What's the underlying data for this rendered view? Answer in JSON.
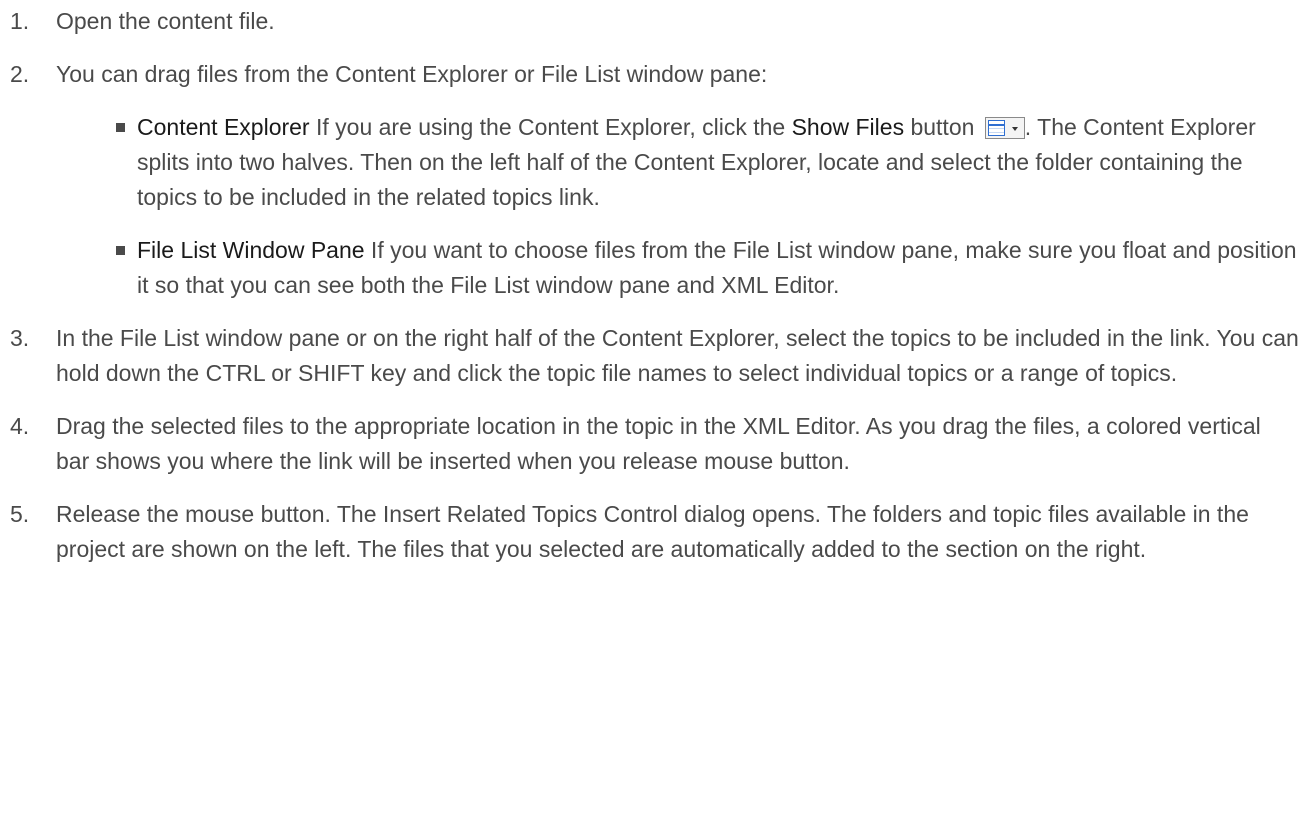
{
  "steps": [
    {
      "number": "1.",
      "text": "Open the content file."
    },
    {
      "number": "2.",
      "text": "You can drag files from the Content Explorer or File List window pane:",
      "subitems": [
        {
          "term": "Content Explorer",
          "text_a": " If you are using the Content Explorer, click the ",
          "button_name": "Show Files",
          "text_b": " button ",
          "text_c": ". The Content Explorer splits into two halves. Then on the left half of the Content Explorer, locate and select the folder containing the topics to be included in the related topics link.",
          "icon": "show-files-icon"
        },
        {
          "term": "File List Window Pane",
          "text": " If you want to choose files from the File List window pane, make sure you float and position it so that you can see both the File List window pane and XML Editor."
        }
      ]
    },
    {
      "number": "3.",
      "text": "In the File List window pane or on the right half of the Content Explorer, select the topics to be included in the link. You can hold down the CTRL or SHIFT key and click the topic file names to select individual topics or a range of topics."
    },
    {
      "number": "4.",
      "text": "Drag the selected files to the appropriate location in the topic in the XML Editor. As you drag the files, a colored vertical bar shows you where the link will be inserted when you release mouse button."
    },
    {
      "number": "5.",
      "text": "Release the mouse button. The Insert Related Topics Control dialog opens. The folders and topic files available in the project are shown on the left. The files that you selected are automatically added to the section on the right."
    }
  ]
}
